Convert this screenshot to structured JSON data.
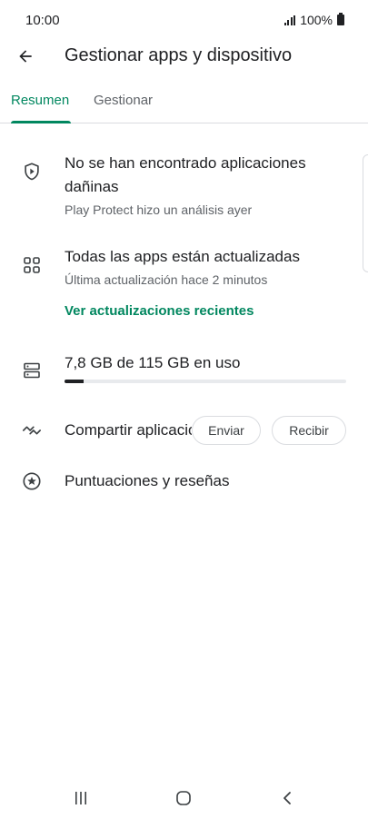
{
  "status_bar": {
    "time": "10:00",
    "battery": "100%"
  },
  "app_bar": {
    "title": "Gestionar apps y dispositivo",
    "back_icon": "arrow-back-icon"
  },
  "tabs": [
    {
      "label": "Resumen",
      "selected": true
    },
    {
      "label": "Gestionar",
      "selected": false
    }
  ],
  "protect": {
    "icon": "shield-play-icon",
    "title": "No se han encontrado aplicaciones dañinas",
    "subtitle": "Play Protect hizo un análisis ayer"
  },
  "updates": {
    "icon": "apps-grid-icon",
    "title": "Todas las apps están actualizadas",
    "subtitle": "Última actualización hace 2 minutos",
    "link": "Ver actualizaciones recientes"
  },
  "storage": {
    "icon": "storage-icon",
    "label": "7,8 GB de 115 GB en uso",
    "used_fraction": 0.068
  },
  "share": {
    "icon": "nearby-share-icon",
    "label": "Compartir aplicaciones",
    "send_label": "Enviar",
    "receive_label": "Recibir"
  },
  "ratings": {
    "icon": "star-circle-icon",
    "label": "Puntuaciones y reseñas"
  },
  "colors": {
    "accent": "#01875f",
    "text": "#202124",
    "secondary": "#5f6368",
    "divider": "#dadce0"
  },
  "nav_bar": {
    "recents_icon": "recents-icon",
    "home_icon": "home-icon",
    "back_icon": "nav-back-icon"
  }
}
